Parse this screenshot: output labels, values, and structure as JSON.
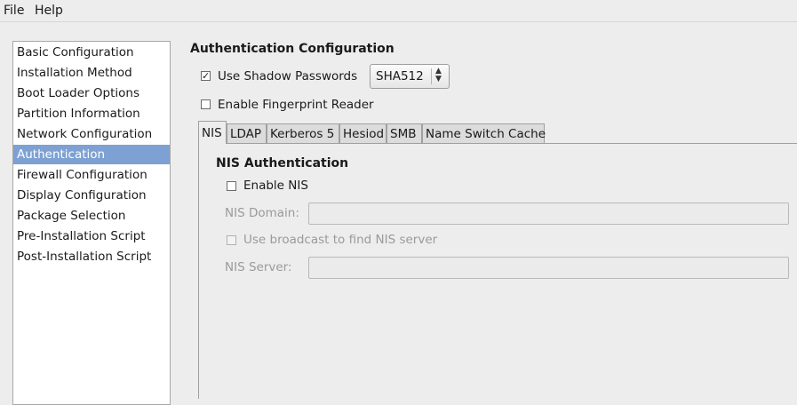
{
  "menu": {
    "file": "File",
    "help": "Help"
  },
  "sidebar": {
    "items": [
      {
        "label": "Basic Configuration"
      },
      {
        "label": "Installation Method"
      },
      {
        "label": "Boot Loader Options"
      },
      {
        "label": "Partition Information"
      },
      {
        "label": "Network Configuration"
      },
      {
        "label": "Authentication",
        "selected": true
      },
      {
        "label": "Firewall Configuration"
      },
      {
        "label": "Display Configuration"
      },
      {
        "label": "Package Selection"
      },
      {
        "label": "Pre-Installation Script"
      },
      {
        "label": "Post-Installation Script"
      }
    ]
  },
  "main": {
    "title": "Authentication Configuration",
    "shadow_passwords": {
      "label": "Use Shadow Passwords",
      "checked": true
    },
    "hash_select": {
      "value": "SHA512"
    },
    "fingerprint": {
      "label": "Enable Fingerprint Reader",
      "checked": false
    },
    "tabs": [
      {
        "label": "NIS",
        "active": true
      },
      {
        "label": "LDAP"
      },
      {
        "label": "Kerberos 5"
      },
      {
        "label": "Hesiod"
      },
      {
        "label": "SMB"
      },
      {
        "label": "Name Switch Cache"
      }
    ],
    "nis": {
      "title": "NIS Authentication",
      "enable": {
        "label": "Enable NIS",
        "checked": false
      },
      "domain_label": "NIS Domain:",
      "domain_value": "",
      "broadcast": {
        "label": "Use broadcast to find NIS server",
        "checked": false
      },
      "server_label": "NIS Server:",
      "server_value": ""
    }
  },
  "colors": {
    "selection": "#7ea1d3",
    "window_bg": "#ededed",
    "disabled_text": "#9a9a9a"
  },
  "icons": {
    "check": "checkmark-icon",
    "spin": "up-down-arrows-icon"
  }
}
